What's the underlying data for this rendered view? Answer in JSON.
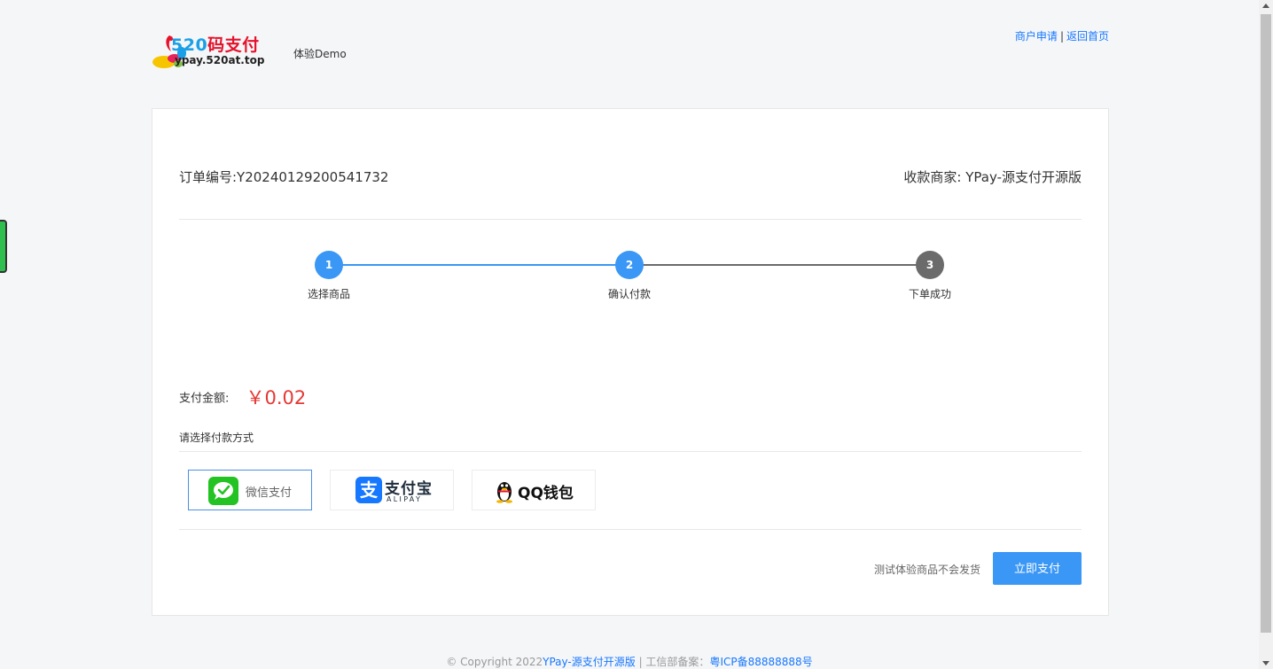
{
  "header": {
    "logo_main": "520",
    "logo_cn": "码支付",
    "logo_domain": "ypay.520at.top",
    "demo_label": "体验Demo",
    "links": [
      {
        "label": "商户申请"
      },
      {
        "label": "返回首页"
      }
    ],
    "link_separator": "|"
  },
  "order": {
    "order_no": "订单编号:Y20240129200541732",
    "merchant": "收款商家: YPay-源支付开源版"
  },
  "steps": [
    {
      "number": "1",
      "label": "选择商品",
      "state": "done"
    },
    {
      "number": "2",
      "label": "确认付款",
      "state": "active"
    },
    {
      "number": "3",
      "label": "下单成功",
      "state": "pending"
    }
  ],
  "payment": {
    "amount_label": "支付金额:",
    "amount_value": "￥0.02",
    "method_title": "请选择付款方式",
    "methods": [
      {
        "name": "wechat",
        "label": "微信支付",
        "icon": "wechat-icon",
        "selected": true
      },
      {
        "name": "alipay",
        "label": "支付宝",
        "sub_label": "ALIPAY",
        "icon": "alipay-icon",
        "selected": false
      },
      {
        "name": "qq",
        "label": "QQ钱包",
        "icon": "qq-penguin-icon",
        "selected": false
      }
    ],
    "note": "测试体验商品不会发货",
    "pay_button": "立即支付"
  },
  "footer": {
    "copyright": "© Copyright 2022",
    "site_link": "YPay-源支付开源版",
    "icp_prefix": " | 工信部备案：",
    "icp_link": "粤ICP备88888888号"
  },
  "colors": {
    "accent": "#3a97f5",
    "amount": "#e53935",
    "step_done": "#3a97f5",
    "step_pending": "#6b6b6b",
    "link": "#1677ff"
  }
}
